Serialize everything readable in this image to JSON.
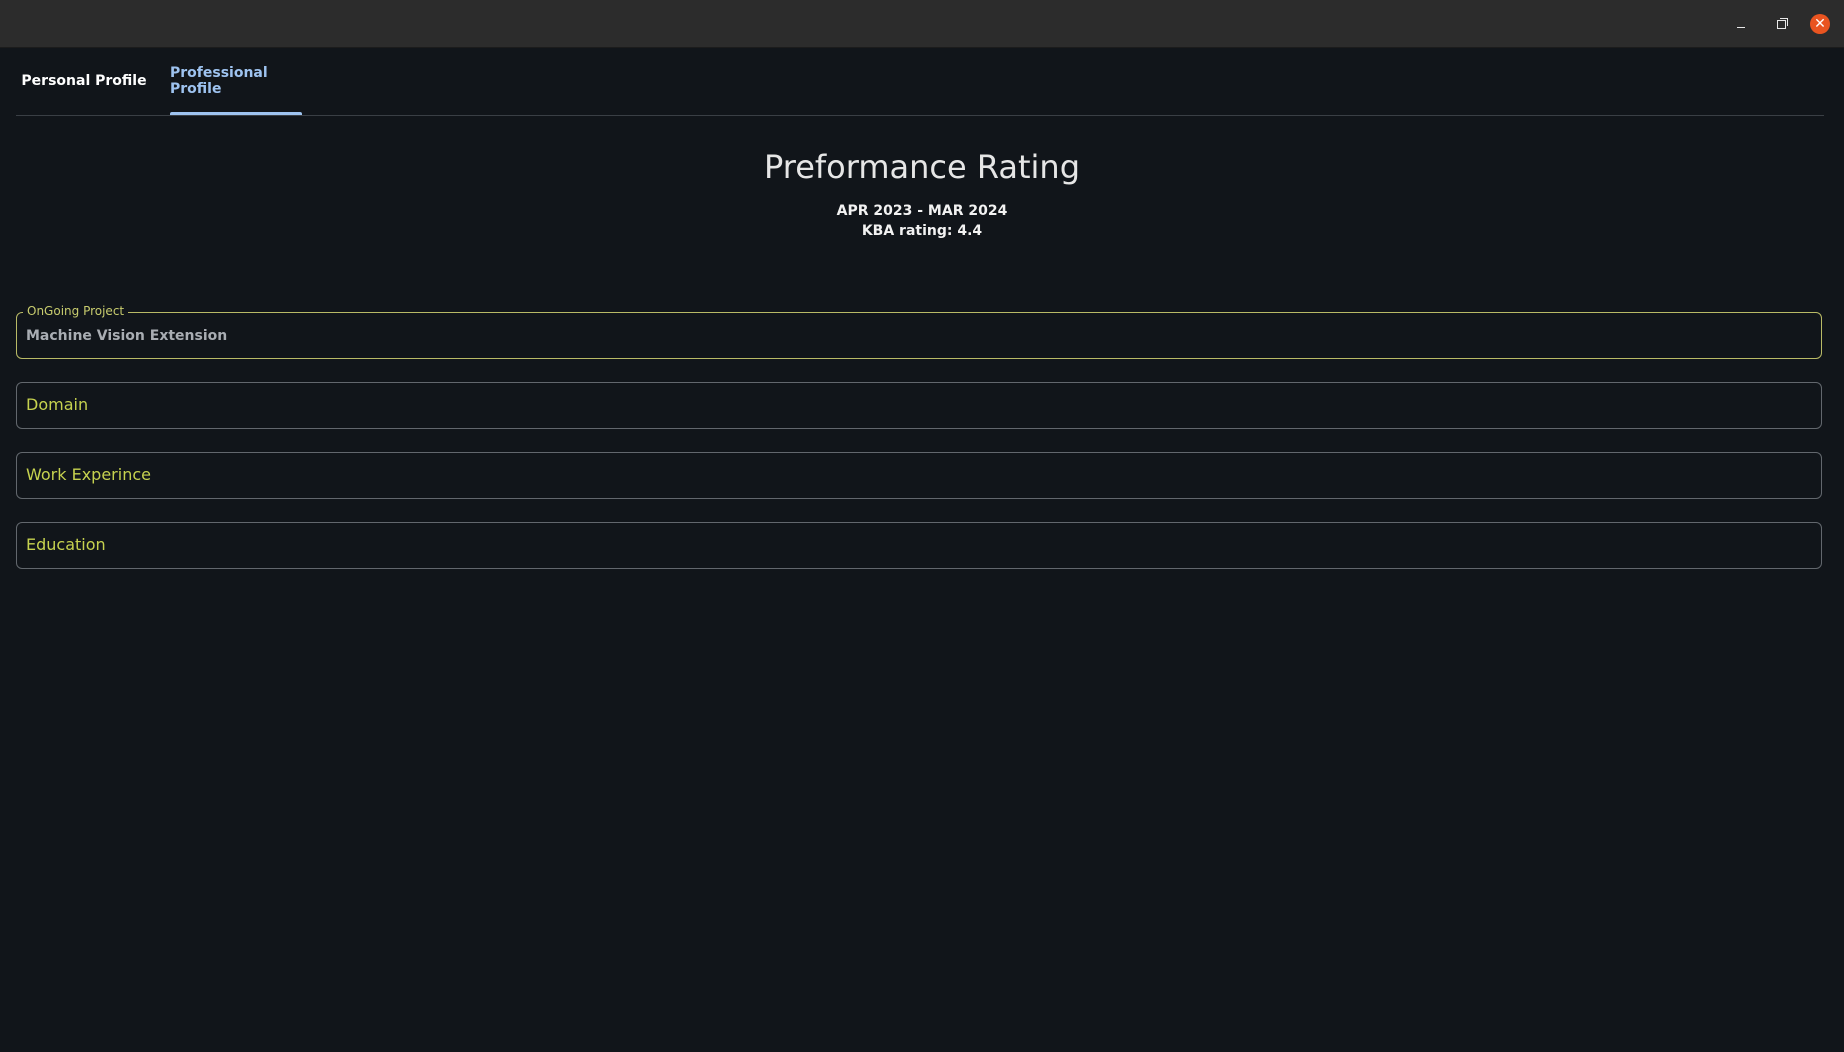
{
  "window": {
    "minimize_icon": "minimize-icon",
    "maximize_icon": "restore-icon",
    "close_icon": "close-icon",
    "close_color": "#e95420"
  },
  "tabs": [
    {
      "label": "Personal Profile",
      "active": false
    },
    {
      "label": "Professional Profile",
      "active": true
    }
  ],
  "accent_tab_color": "#9ec3f0",
  "header": {
    "title": "Preformance Rating",
    "period": "APR 2023 - MAR 2024",
    "rating": "KBA rating: 4.4"
  },
  "project": {
    "label": "OnGoing Project",
    "value": "Machine Vision Extension",
    "border_color": "#b9ba66"
  },
  "sections": [
    {
      "label": "Domain"
    },
    {
      "label": "Work Experince"
    },
    {
      "label": "Education"
    }
  ],
  "section_label_color": "#c6d24f"
}
